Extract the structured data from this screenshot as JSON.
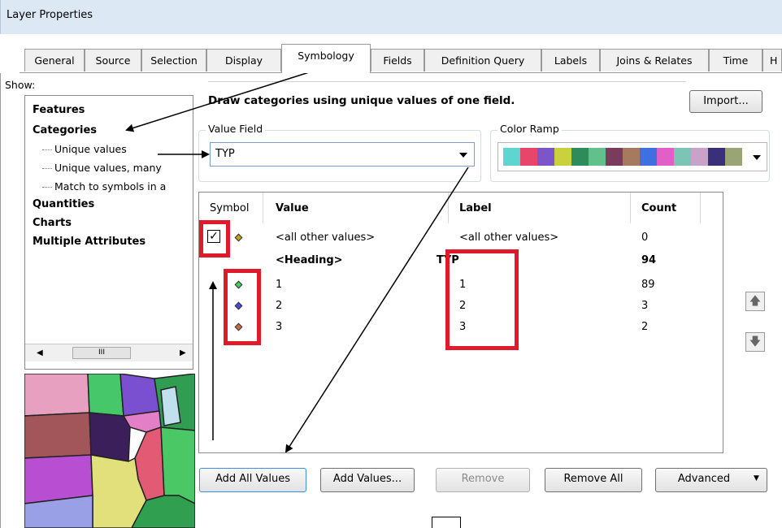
{
  "window": {
    "title": "Layer Properties"
  },
  "tabs": [
    {
      "label": "General"
    },
    {
      "label": "Source"
    },
    {
      "label": "Selection"
    },
    {
      "label": "Display"
    },
    {
      "label": "Symbology"
    },
    {
      "label": "Fields"
    },
    {
      "label": "Definition Query"
    },
    {
      "label": "Labels"
    },
    {
      "label": "Joins & Relates"
    },
    {
      "label": "Time"
    },
    {
      "label": "H"
    }
  ],
  "active_tab": "Symbology",
  "show": {
    "label": "Show:",
    "items": [
      {
        "label": "Features"
      },
      {
        "label": "Categories"
      },
      {
        "label": "Unique values"
      },
      {
        "label": "Unique values, many"
      },
      {
        "label": "Match to symbols in a"
      },
      {
        "label": "Quantities"
      },
      {
        "label": "Charts"
      },
      {
        "label": "Multiple Attributes"
      }
    ],
    "scroll_thumb": "III"
  },
  "symbology": {
    "description": "Draw categories using unique values of one field.",
    "import_label": "Import...",
    "value_field": {
      "label": "Value Field",
      "value": "TYP"
    },
    "color_ramp": {
      "label": "Color Ramp",
      "colors": [
        "#5ed5d0",
        "#e8456a",
        "#7c55c8",
        "#cbd13d",
        "#2d8c5a",
        "#62c08a",
        "#7a3b5c",
        "#a57a5e",
        "#3f6fe0",
        "#e15fc7",
        "#7cc4b5",
        "#c8a2c8",
        "#3a2f7a",
        "#9aa575"
      ]
    }
  },
  "grid": {
    "headers": {
      "symbol": "Symbol",
      "value": "Value",
      "label": "Label",
      "count": "Count"
    },
    "rows": [
      {
        "value": "<all other values>",
        "label": "<all other values>",
        "count": "0",
        "color": "#c0a020",
        "checkbox": "✓"
      },
      {
        "value": "<Heading>",
        "label": "TYP",
        "count": "94",
        "heading": true
      },
      {
        "value": "1",
        "label": "1",
        "count": "89",
        "color": "#3fcf5f"
      },
      {
        "value": "2",
        "label": "2",
        "count": "3",
        "color": "#4a4ad8"
      },
      {
        "value": "3",
        "label": "3",
        "count": "2",
        "color": "#c86a4a"
      }
    ]
  },
  "buttons": {
    "add_all": "Add All Values",
    "add_values": "Add Values...",
    "remove": "Remove",
    "remove_all": "Remove All",
    "advanced": "Advanced"
  },
  "icons": {
    "move_up": "arrow-up-icon",
    "move_down": "arrow-down-icon"
  }
}
